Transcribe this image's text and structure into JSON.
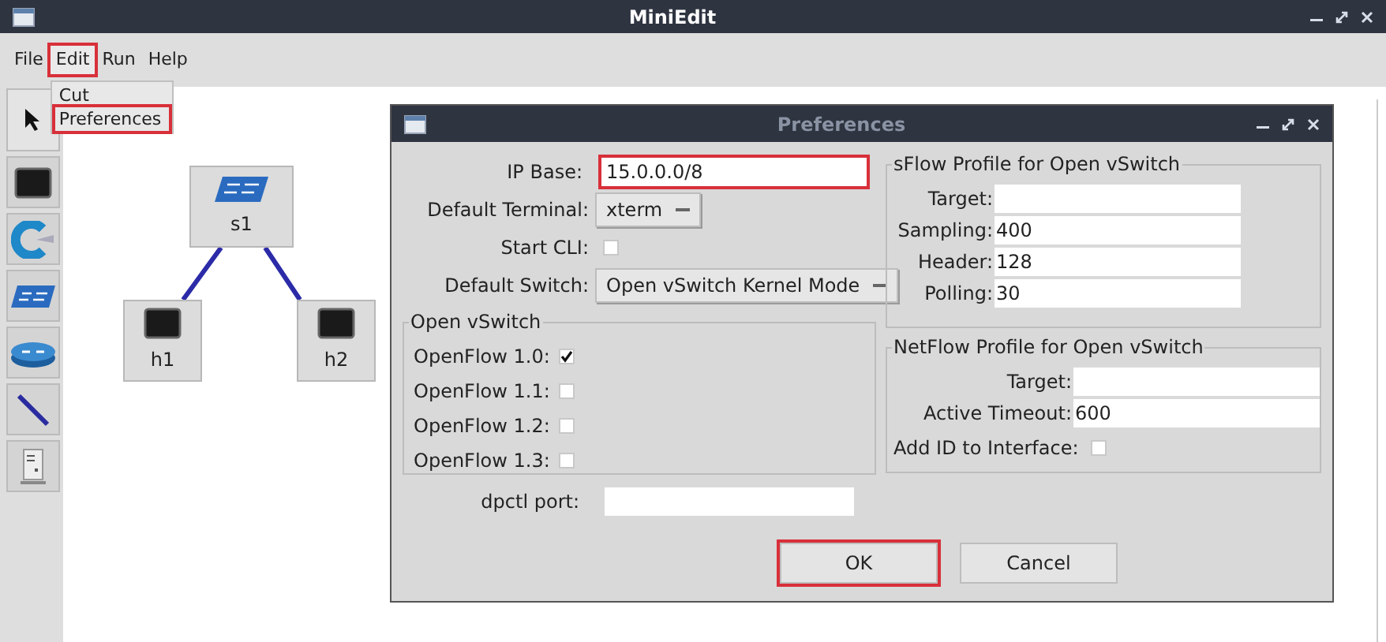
{
  "window": {
    "title": "MiniEdit"
  },
  "menu": [
    {
      "label": "File",
      "highlighted": false,
      "open": false
    },
    {
      "label": "Edit",
      "highlighted": true,
      "open": true,
      "items": [
        {
          "label": "Cut",
          "highlighted": false
        },
        {
          "label": "Preferences",
          "highlighted": true
        }
      ]
    },
    {
      "label": "Run",
      "highlighted": false,
      "open": false
    },
    {
      "label": "Help",
      "highlighted": false,
      "open": false
    }
  ],
  "toolbar": [
    {
      "kind": "select"
    },
    {
      "kind": "host"
    },
    {
      "kind": "controller"
    },
    {
      "kind": "switch"
    },
    {
      "kind": "router"
    },
    {
      "kind": "link"
    },
    {
      "kind": "server"
    }
  ],
  "canvas": {
    "nodes": [
      {
        "label": "s1",
        "kind": "switch"
      },
      {
        "label": "h1",
        "kind": "host",
        "connected": true
      },
      {
        "label": "h2",
        "kind": "host",
        "connected": true
      }
    ]
  },
  "dialog": {
    "title": "Preferences",
    "ip_base": {
      "label": "IP Base:",
      "value": "15.0.0.0/8",
      "highlighted": true
    },
    "default_terminal": {
      "label": "Default Terminal:",
      "value": "xterm"
    },
    "start_cli": {
      "label": "Start CLI:",
      "checked": false
    },
    "default_switch": {
      "label": "Default Switch:",
      "value": "Open vSwitch Kernel Mode"
    },
    "open_vswitch": {
      "title": "Open vSwitch",
      "options": [
        {
          "label": "OpenFlow 1.0:",
          "checked": true
        },
        {
          "label": "OpenFlow 1.1:",
          "checked": false
        },
        {
          "label": "OpenFlow 1.2:",
          "checked": false
        },
        {
          "label": "OpenFlow 1.3:",
          "checked": false
        }
      ]
    },
    "dpctl_port": {
      "label": "dpctl port:"
    },
    "sflow": {
      "title": "sFlow Profile for Open vSwitch",
      "fields": [
        {
          "label": "Target:"
        },
        {
          "label": "Sampling:",
          "value": "400"
        },
        {
          "label": "Header:",
          "value": "128"
        },
        {
          "label": "Polling:",
          "value": "30"
        }
      ]
    },
    "netflow": {
      "title": "NetFlow Profile for Open vSwitch",
      "fields": [
        {
          "label": "Target:"
        },
        {
          "label": "Active Timeout:",
          "value": "600"
        }
      ],
      "add_id": {
        "label": "Add ID to Interface:",
        "checked": false
      }
    },
    "buttons": [
      {
        "label": "OK",
        "highlighted": true
      },
      {
        "label": "Cancel",
        "highlighted": false
      }
    ]
  }
}
